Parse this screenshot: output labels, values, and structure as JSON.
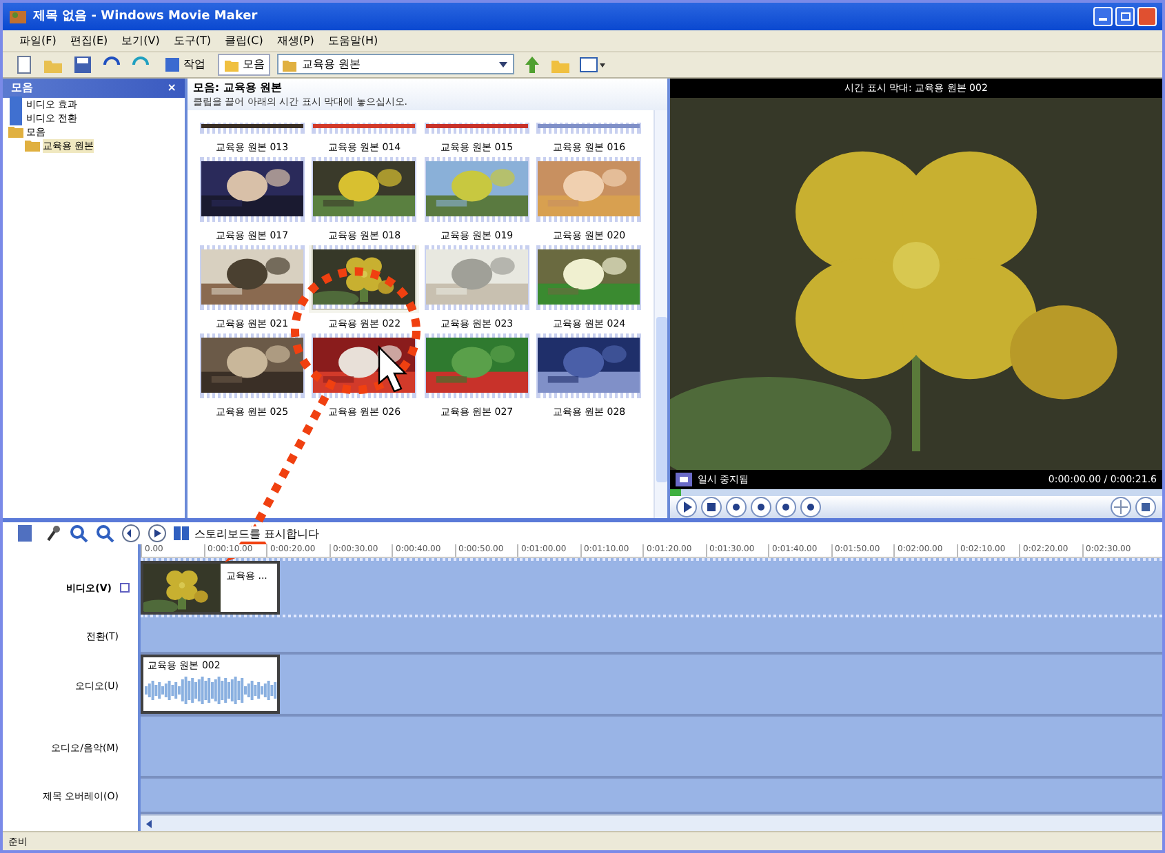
{
  "window": {
    "title": "제목 없음 - Windows Movie Maker"
  },
  "menu": [
    "파일(F)",
    "편집(E)",
    "보기(V)",
    "도구(T)",
    "클립(C)",
    "재생(P)",
    "도움말(H)"
  ],
  "toolbar": {
    "buttons": [
      {
        "label": "작업",
        "selected": false
      },
      {
        "label": "모음",
        "selected": true
      }
    ],
    "location": "교육용 원본"
  },
  "tasks_pane": {
    "title": "모음",
    "close": "×",
    "items": [
      {
        "label": "비디오 효과",
        "selected": false
      },
      {
        "label": "비디오 전환",
        "selected": false
      },
      {
        "label": "모음",
        "selected": false,
        "children": [
          {
            "label": "교육용 원본",
            "selected": true
          }
        ]
      }
    ]
  },
  "collection": {
    "title": "모음: 교육용 원본",
    "hint": "클립을 끌어 아래의 시간 표시 막대에 놓으십시오.",
    "clips": [
      {
        "label": "교육용 원본 013",
        "selected": false
      },
      {
        "label": "교육용 원본 014",
        "selected": false
      },
      {
        "label": "교육용 원본 015",
        "selected": false
      },
      {
        "label": "교육용 원본 016",
        "selected": false
      },
      {
        "label": "교육용 원본 017",
        "selected": false
      },
      {
        "label": "교육용 원본 018",
        "selected": false
      },
      {
        "label": "교육용 원본 019",
        "selected": false
      },
      {
        "label": "교육용 원본 020",
        "selected": false
      },
      {
        "label": "교육용 원본 021",
        "selected": false
      },
      {
        "label": "교육용 원본 022",
        "selected": true
      },
      {
        "label": "교육용 원본 023",
        "selected": false
      },
      {
        "label": "교육용 원본 024",
        "selected": false
      },
      {
        "label": "교육용 원본 025",
        "selected": false
      },
      {
        "label": "교육용 원본 026",
        "selected": false
      },
      {
        "label": "교육용 원본 027",
        "selected": false
      },
      {
        "label": "교육용 원본 028",
        "selected": false
      }
    ]
  },
  "preview": {
    "title": "시간 표시 막대: 교육용 원본 002",
    "status": "일시 중지됨",
    "time": "0:00:00.00 / 0:00:21.6",
    "seek": {
      "level": 0
    }
  },
  "timeline": {
    "toolbar_label": "스토리보드를 표시합니다",
    "ticks": [
      "0.00",
      "0:00:10.00",
      "0:00:20.00",
      "0:00:30.00",
      "0:00:40.00",
      "0:00:50.00",
      "0:01:00.00",
      "0:01:10.00",
      "0:01:20.00",
      "0:01:30.00",
      "0:01:40.00",
      "0:01:50.00",
      "0:02:00.00",
      "0:02:10.00",
      "0:02:20.00",
      "0:02:30.00"
    ],
    "tracks": [
      {
        "label": "비디오(V)",
        "kind": "video",
        "clips": [
          {
            "label": "교육용 ..."
          }
        ]
      },
      {
        "label": "전환(T)",
        "kind": "transition"
      },
      {
        "label": "오디오(U)",
        "kind": "audio",
        "clips": [
          {
            "label": "교육용 원본 002"
          }
        ]
      },
      {
        "label": "오디오/음악(M)",
        "kind": "music"
      },
      {
        "label": "제목 오버레이(O)",
        "kind": "title"
      }
    ]
  },
  "status_bar": "준비"
}
